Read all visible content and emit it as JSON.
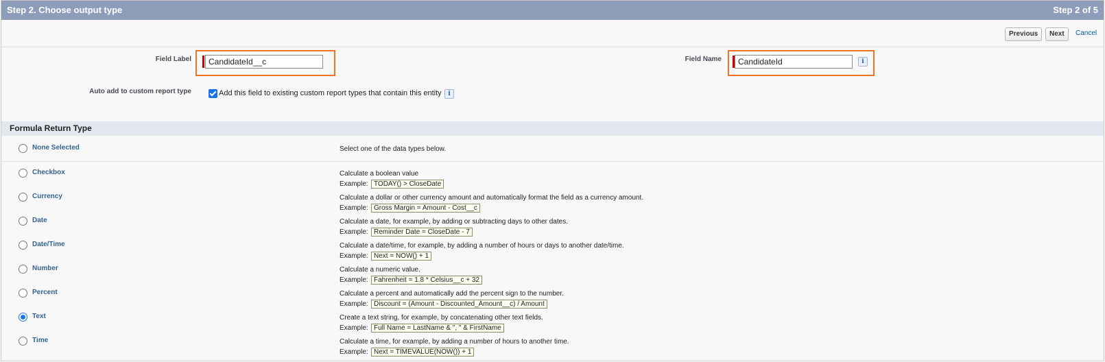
{
  "header": {
    "title": "Step 2. Choose output type",
    "step": "Step 2 of 5"
  },
  "toolbar": {
    "previous": "Previous",
    "next": "Next",
    "cancel": "Cancel"
  },
  "form": {
    "field_label": {
      "label": "Field Label",
      "value": "CandidateId__c"
    },
    "field_name": {
      "label": "Field Name",
      "value": "CandidateId"
    },
    "auto_add": {
      "label": "Auto add to custom report type",
      "checkbox_text": "Add this field to existing custom report types that contain this entity",
      "checked": true
    },
    "info_icon": "info-icon"
  },
  "section": {
    "title": "Formula Return Type"
  },
  "return_types": [
    {
      "label": "None Selected",
      "description": "Select one of the data types below.",
      "example_label": "",
      "example": "",
      "selected": false
    },
    {
      "label": "Checkbox",
      "description": "Calculate a boolean value",
      "example_label": "Example:",
      "example": "TODAY() > CloseDate",
      "selected": false
    },
    {
      "label": "Currency",
      "description": "Calculate a dollar or other currency amount and automatically format the field as a currency amount.",
      "example_label": "Example:",
      "example": "Gross Margin = Amount - Cost__c",
      "selected": false
    },
    {
      "label": "Date",
      "description": "Calculate a date, for example, by adding or subtracting days to other dates.",
      "example_label": "Example:",
      "example": "Reminder Date = CloseDate - 7",
      "selected": false
    },
    {
      "label": "Date/Time",
      "description": "Calculate a date/time, for example, by adding a number of hours or days to another date/time.",
      "example_label": "Example:",
      "example": "Next = NOW() + 1",
      "selected": false
    },
    {
      "label": "Number",
      "description": "Calculate a numeric value.",
      "example_label": "Example:",
      "example": "Fahrenheit = 1.8 * Celsius__c + 32",
      "selected": false
    },
    {
      "label": "Percent",
      "description": "Calculate a percent and automatically add the percent sign to the number.",
      "example_label": "Example:",
      "example": "Discount = (Amount - Discounted_Amount__c) / Amount",
      "selected": false
    },
    {
      "label": "Text",
      "description": "Create a text string, for example, by concatenating other text fields.",
      "example_label": "Example:",
      "example": "Full Name = LastName & \", \" & FirstName",
      "selected": true
    },
    {
      "label": "Time",
      "description": "Calculate a time, for example, by adding a number of hours to another time.",
      "example_label": "Example:",
      "example": "Next = TIMEVALUE(NOW()) + 1",
      "selected": false
    }
  ],
  "colors": {
    "header": "#8e9dba",
    "highlight": "#ee7322",
    "accent": "#1a73e8",
    "link": "#015ba7"
  }
}
